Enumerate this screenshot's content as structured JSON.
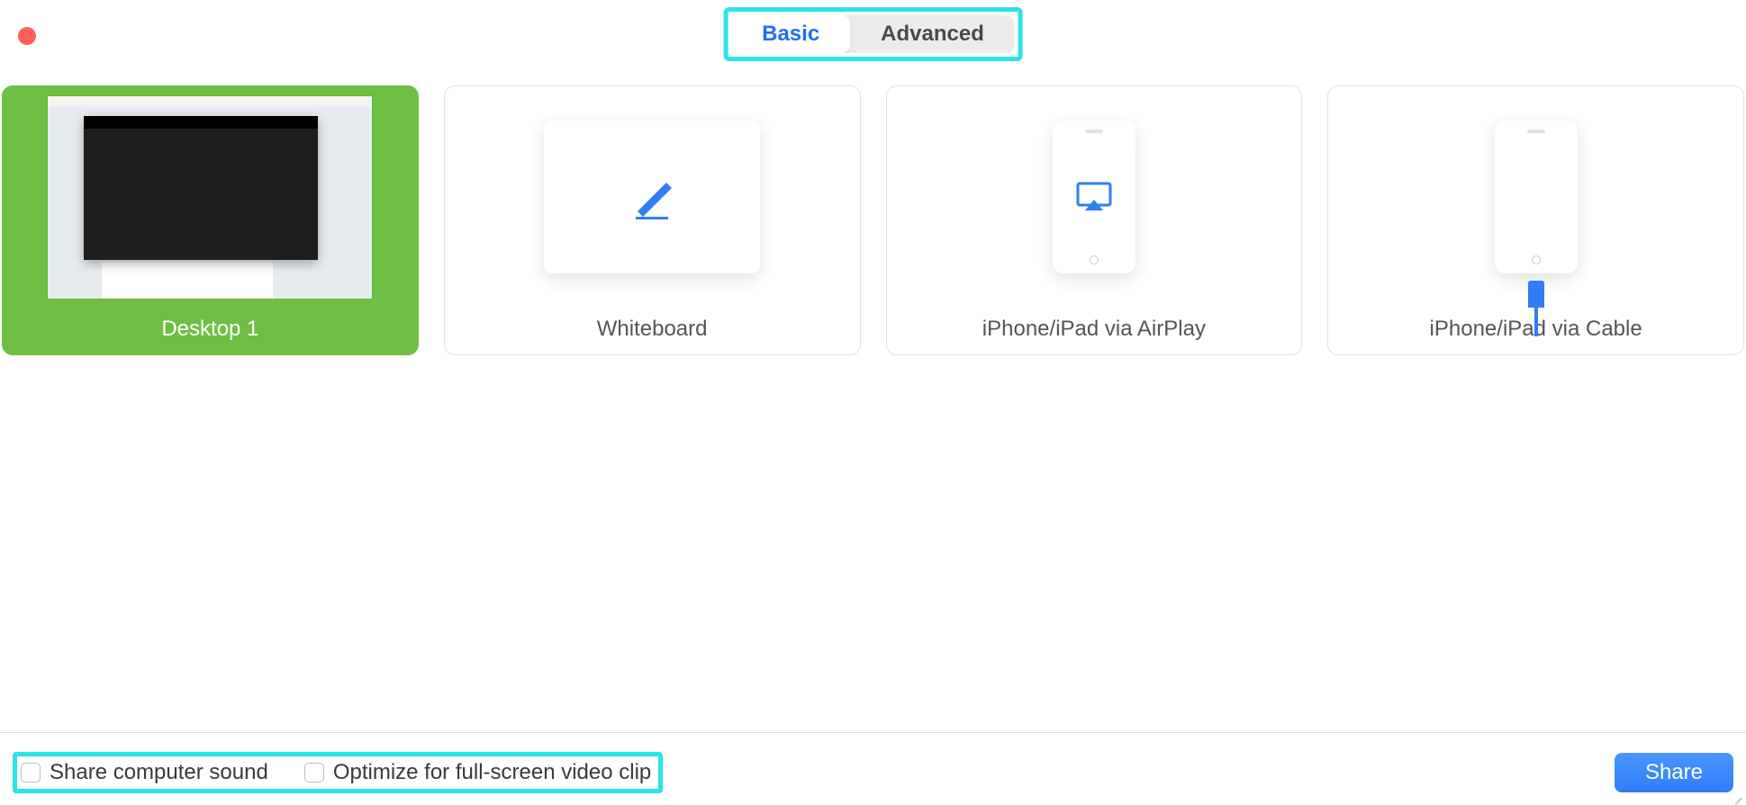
{
  "tabs": {
    "basic": "Basic",
    "advanced": "Advanced",
    "active": "basic"
  },
  "tiles": [
    {
      "id": "desktop1",
      "label": "Desktop 1",
      "selected": true
    },
    {
      "id": "whiteboard",
      "label": "Whiteboard",
      "selected": false
    },
    {
      "id": "airplay",
      "label": "iPhone/iPad via AirPlay",
      "selected": false
    },
    {
      "id": "cable",
      "label": "iPhone/iPad via Cable",
      "selected": false
    }
  ],
  "footer": {
    "share_sound": "Share computer sound",
    "optimize_video": "Optimize for full-screen video clip",
    "share_button": "Share"
  },
  "colors": {
    "accent": "#2f7ef7",
    "selected": "#6fbf44",
    "highlight": "#2be3e8"
  }
}
